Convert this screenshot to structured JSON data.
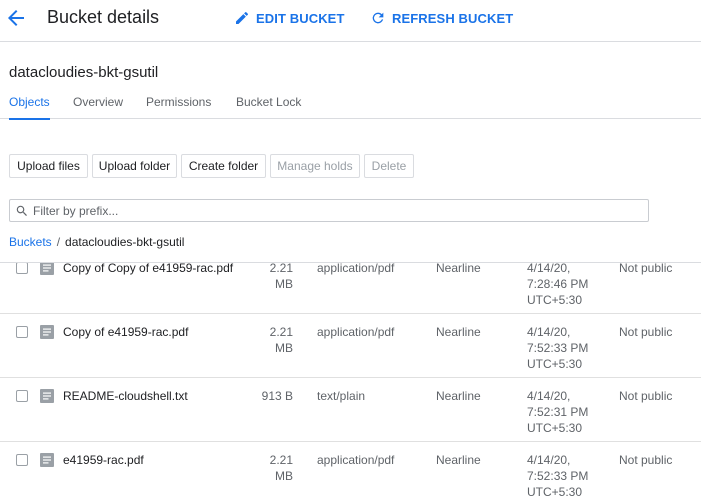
{
  "header": {
    "title": "Bucket details",
    "edit_label": "EDIT BUCKET",
    "refresh_label": "REFRESH BUCKET",
    "accent_color": "#1a73e8"
  },
  "bucket": {
    "name": "datacloudies-bkt-gsutil"
  },
  "tabs": [
    {
      "label": "Objects",
      "active": true
    },
    {
      "label": "Overview",
      "active": false
    },
    {
      "label": "Permissions",
      "active": false
    },
    {
      "label": "Bucket Lock",
      "active": false
    }
  ],
  "toolbar": {
    "upload_files": "Upload files",
    "upload_folder": "Upload folder",
    "create_folder": "Create folder",
    "manage_holds": "Manage holds",
    "delete": "Delete"
  },
  "filter": {
    "placeholder": "Filter by prefix...",
    "value": ""
  },
  "breadcrumb": {
    "root": "Buckets",
    "separator": "/",
    "current": "datacloudies-bkt-gsutil"
  },
  "objects": [
    {
      "name": "Copy of Copy of e41959-rac.pdf",
      "size_value": "2.21",
      "size_unit": "MB",
      "type": "application/pdf",
      "storage_class": "Nearline",
      "date": "4/14/20,",
      "time": "7:28:46 PM",
      "tz": "UTC+5:30",
      "access": "Not public"
    },
    {
      "name": "Copy of e41959-rac.pdf",
      "size_value": "2.21",
      "size_unit": "MB",
      "type": "application/pdf",
      "storage_class": "Nearline",
      "date": "4/14/20,",
      "time": "7:52:33 PM",
      "tz": "UTC+5:30",
      "access": "Not public"
    },
    {
      "name": "README-cloudshell.txt",
      "size_value": "913 B",
      "size_unit": "",
      "type": "text/plain",
      "storage_class": "Nearline",
      "date": "4/14/20,",
      "time": "7:52:31 PM",
      "tz": "UTC+5:30",
      "access": "Not public"
    },
    {
      "name": "e41959-rac.pdf",
      "size_value": "2.21",
      "size_unit": "MB",
      "type": "application/pdf",
      "storage_class": "Nearline",
      "date": "4/14/20,",
      "time": "7:52:33 PM",
      "tz": "UTC+5:30",
      "access": "Not public"
    }
  ],
  "icons": {
    "back": "arrow-back-icon",
    "edit": "pencil-icon",
    "refresh": "refresh-icon",
    "search": "search-icon",
    "file": "file-icon"
  }
}
